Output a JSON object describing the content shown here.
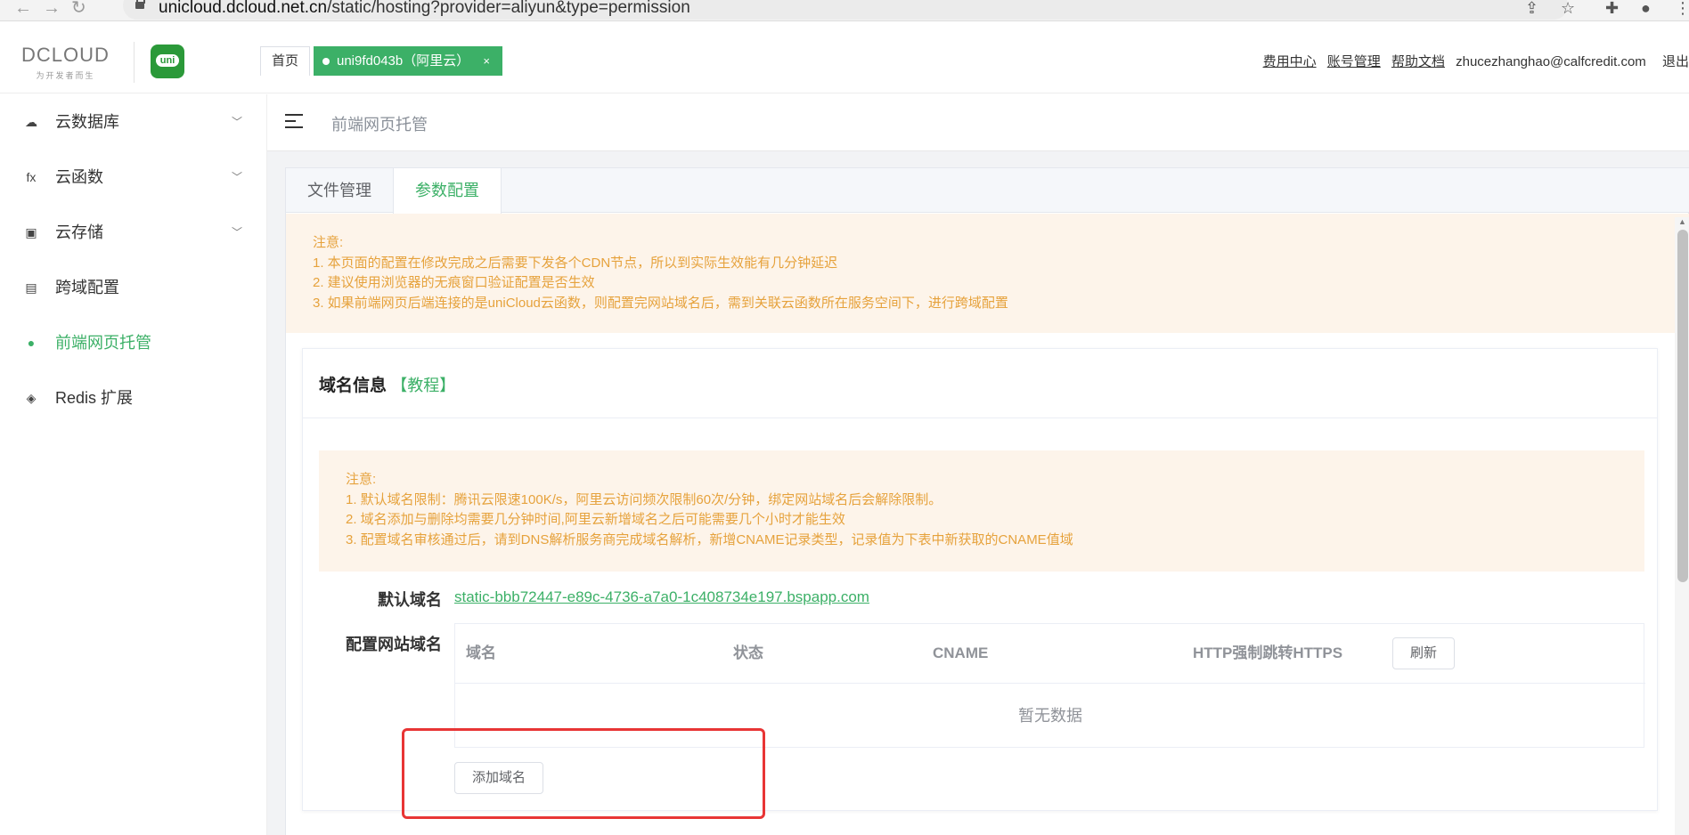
{
  "browser": {
    "url_host": "unicloud.dcloud.net.cn",
    "url_path": "/static/hosting?provider=aliyun&type=permission"
  },
  "header": {
    "logo_text": "DCLOUD",
    "logo_tagline": "为开发者而生",
    "app_logo_text": "uni",
    "tab_home": "首页",
    "tab_project": "uni9fd043b（阿里云）",
    "tab_close": "×",
    "links": {
      "billing": "费用中心",
      "account": "账号管理",
      "help": "帮助文档",
      "email": "zhucezhanghao@calfcredit.com",
      "logout": "退出"
    }
  },
  "sidebar": {
    "items": [
      {
        "label": "云数据库",
        "icon": "cloud-db-icon",
        "has_children": true
      },
      {
        "label": "云函数",
        "icon": "fx-icon",
        "icon_text": "fx",
        "has_children": true
      },
      {
        "label": "云存储",
        "icon": "storage-icon",
        "has_children": true
      },
      {
        "label": "跨域配置",
        "icon": "cors-icon",
        "has_children": false
      },
      {
        "label": "前端网页托管",
        "icon": "hosting-icon",
        "has_children": false,
        "active": true
      },
      {
        "label": "Redis 扩展",
        "icon": "redis-icon",
        "has_children": false
      }
    ]
  },
  "page": {
    "breadcrumb_title": "前端网页托管",
    "tabs": [
      "文件管理",
      "参数配置"
    ],
    "active_tab": "参数配置",
    "notice_top": {
      "heading": "注意:",
      "lines": [
        "1. 本页面的配置在修改完成之后需要下发各个CDN节点，所以到实际生效能有几分钟延迟",
        "2. 建议使用浏览器的无痕窗口验证配置是否生效",
        "3. 如果前端网页后端连接的是uniCloud云函数，则配置完网站域名后，需到关联云函数所在服务空间下，进行跨域配置"
      ]
    },
    "domain_card": {
      "title": "域名信息",
      "tutorial_link": "【教程】",
      "notice": {
        "heading": "注意:",
        "lines": [
          "1. 默认域名限制：腾讯云限速100K/s，阿里云访问频次限制60次/分钟，绑定网站域名后会解除限制。",
          "2. 域名添加与删除均需要几分钟时间,阿里云新增域名之后可能需要几个小时才能生效",
          "3. 配置域名审核通过后，请到DNS解析服务商完成域名解析，新增CNAME记录类型，记录值为下表中新获取的CNAME值域"
        ]
      },
      "default_domain_label": "默认域名",
      "default_domain_value": "static-bbb72447-e89c-4736-a7a0-1c408734e197.bspapp.com",
      "site_domain_label": "配置网站域名",
      "table": {
        "columns": [
          "域名",
          "状态",
          "CNAME",
          "HTTP强制跳转HTTPS"
        ],
        "refresh_label": "刷新",
        "empty_text": "暂无数据",
        "rows": []
      },
      "add_button_label": "添加域名"
    }
  },
  "colors": {
    "accent": "#3cb067",
    "notice_bg": "#fdf4ea",
    "notice_text": "#e6a23c",
    "highlight": "#e83535"
  }
}
